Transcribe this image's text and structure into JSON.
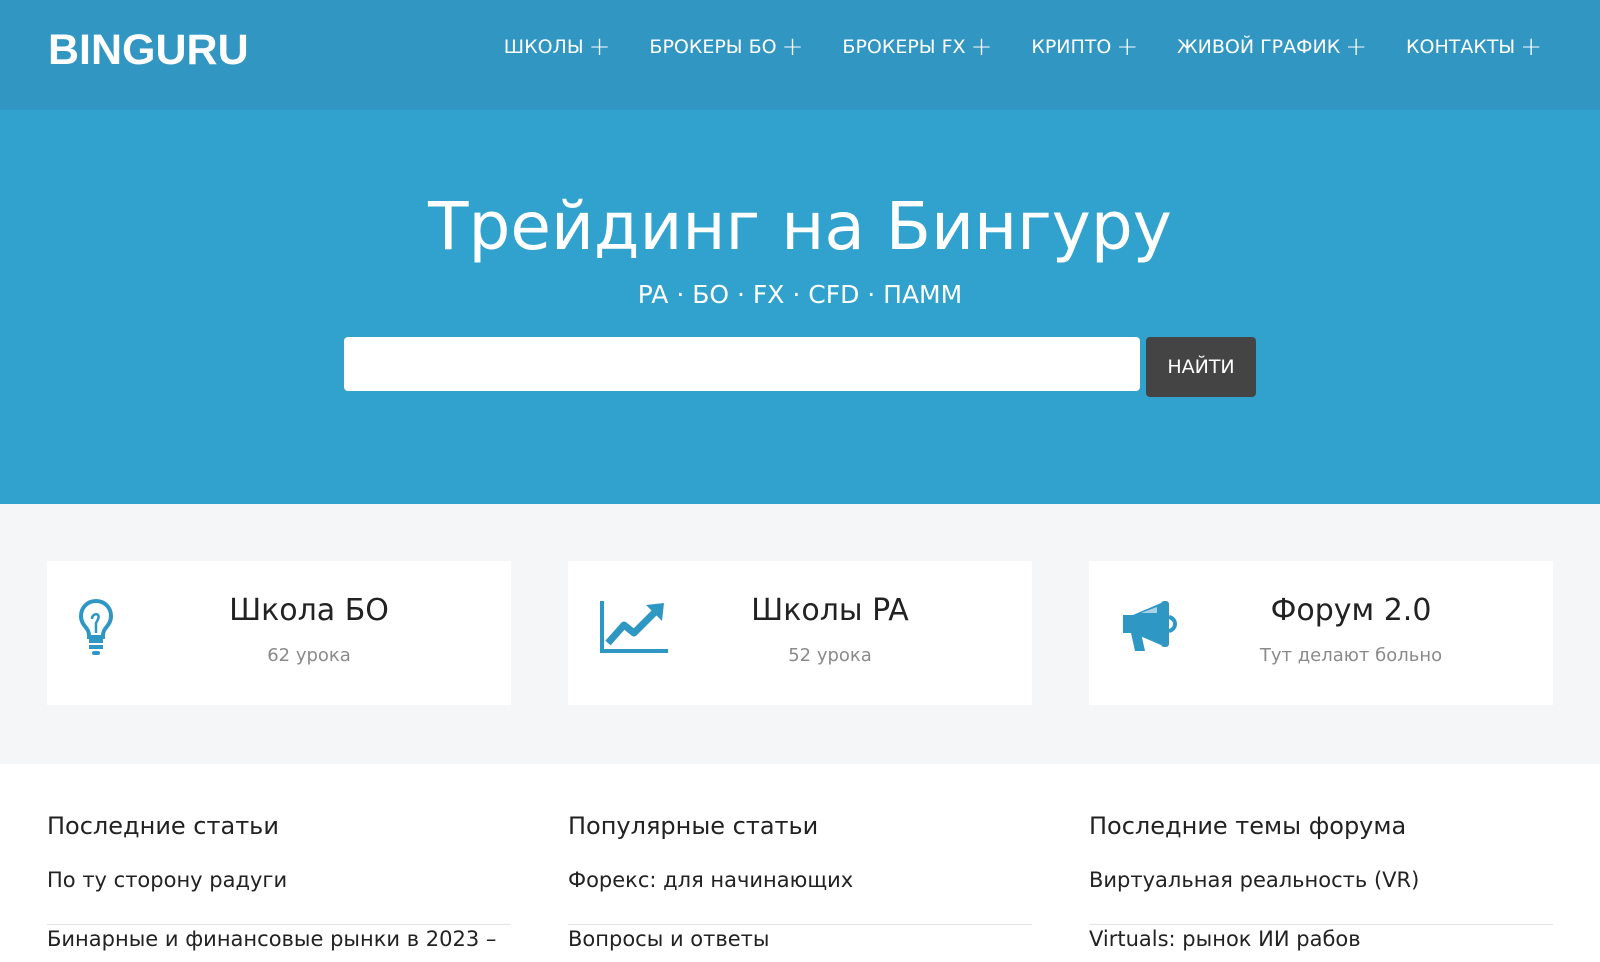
{
  "header": {
    "logo": "BINGURU",
    "nav": [
      {
        "label": "ШКОЛЫ",
        "icon": "plus-icon"
      },
      {
        "label": "БРОКЕРЫ БО",
        "icon": "plus-icon"
      },
      {
        "label": "БРОКЕРЫ FX",
        "icon": "plus-icon"
      },
      {
        "label": "КРИПТО",
        "icon": "plus-icon"
      },
      {
        "label": "ЖИВОЙ ГРАФИК",
        "icon": "plus-icon"
      },
      {
        "label": "КОНТАКТЫ",
        "icon": "plus-icon"
      }
    ]
  },
  "hero": {
    "title": "Трейдинг на Бингуру",
    "subtitle": "PA · БО · FX · CFD · ПАММ",
    "search_value": "",
    "search_button": "НАЙТИ"
  },
  "features": [
    {
      "title": "Школа БО",
      "subtitle": "62 урока",
      "icon": "lightbulb-icon"
    },
    {
      "title": "Школы PA",
      "subtitle": "52 урока",
      "icon": "trend-chart-icon"
    },
    {
      "title": "Форум 2.0",
      "subtitle": "Тут делают больно",
      "icon": "megaphone-icon"
    }
  ],
  "lists": [
    {
      "title": "Последние статьи",
      "items": [
        "По ту сторону радуги",
        "Бинарные и финансовые рынки в 2023 –"
      ]
    },
    {
      "title": "Популярные статьи",
      "items": [
        "Форекс: для начинающих",
        "Вопросы и ответы"
      ]
    },
    {
      "title": "Последние темы форума",
      "items": [
        "Виртуальная реальность (VR)",
        "Virtuals: рынок ИИ рабов"
      ]
    }
  ],
  "colors": {
    "header_bg": "#3196c2",
    "hero_bg": "#30a2cd",
    "accent_icon": "#2f97c4",
    "button_bg": "#444444"
  }
}
